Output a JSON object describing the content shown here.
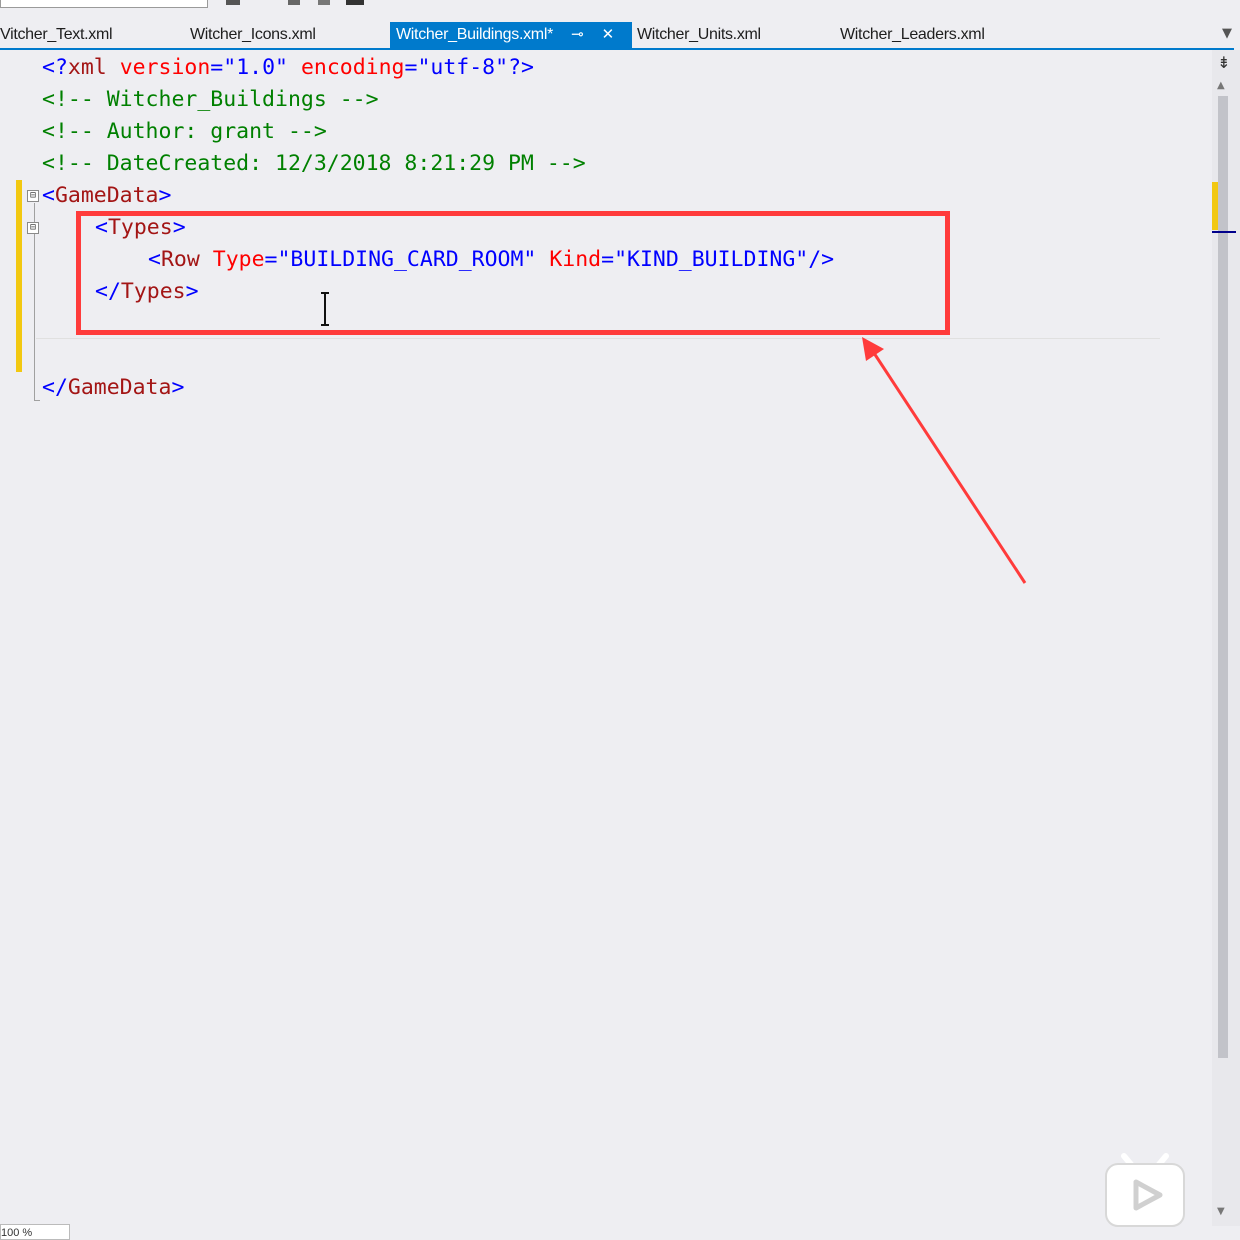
{
  "tabs": [
    {
      "label": "Vitcher_Text.xml",
      "active": false
    },
    {
      "label": "Witcher_Icons.xml",
      "active": false
    },
    {
      "label": "Witcher_Buildings.xml*",
      "active": true
    },
    {
      "label": "Witcher_Units.xml",
      "active": false
    },
    {
      "label": "Witcher_Leaders.xml",
      "active": false
    }
  ],
  "tab_icons": {
    "pin": "pin-icon",
    "close": "close-icon",
    "dropdown": "chevron-down-icon"
  },
  "code": {
    "line1": {
      "open": "<?",
      "tag": "xml",
      "a1": "version",
      "eq1": "=",
      "v1": "\"1.0\"",
      "a2": "encoding",
      "eq2": "=",
      "v2": "\"utf-8\"",
      "close": "?>"
    },
    "line2": "<!-- Witcher_Buildings -->",
    "line3": "<!-- Author: grant -->",
    "line4": "<!-- DateCreated: 12/3/2018 8:21:29 PM -->",
    "line5": {
      "open": "<",
      "tag": "GameData",
      "close": ">"
    },
    "line6": {
      "open": "<",
      "tag": "Types",
      "close": ">"
    },
    "line7": {
      "open": "<",
      "tag": "Row",
      "a1": "Type",
      "eq1": "=",
      "v1": "\"BUILDING_CARD_ROOM\"",
      "a2": "Kind",
      "eq2": "=",
      "v2": "\"KIND_BUILDING\"",
      "close": "/>"
    },
    "line8": {
      "open": "</",
      "tag": "Types",
      "close": ">"
    },
    "line10": {
      "open": "</",
      "tag": "GameData",
      "close": ">"
    }
  },
  "fold_markers": {
    "minus": "⊟"
  },
  "scrollbar": {
    "split": "⇟",
    "up": "▲",
    "down": "▼"
  },
  "status": {
    "zoom": "100 %"
  },
  "colors": {
    "accent": "#007acc",
    "annotation": "#ff3b3b",
    "change_marker": "#f2c811"
  }
}
